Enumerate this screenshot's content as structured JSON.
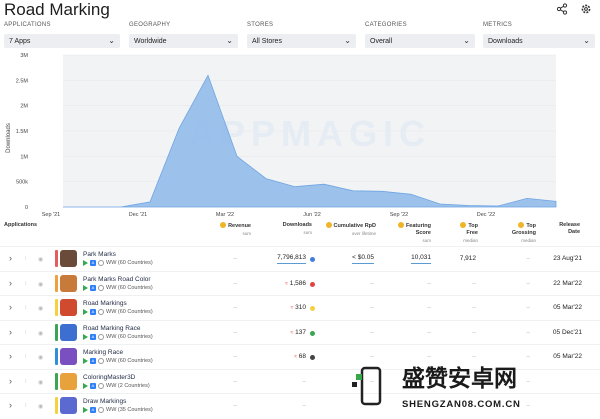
{
  "page": {
    "title": "Road Marking"
  },
  "filters": [
    {
      "label": "APPLICATIONS",
      "value": "7 Apps"
    },
    {
      "label": "GEOGRAPHY",
      "value": "Worldwide"
    },
    {
      "label": "STORES",
      "value": "All Stores"
    },
    {
      "label": "CATEGORIES",
      "value": "Overall"
    },
    {
      "label": "METRICS",
      "value": "Downloads"
    }
  ],
  "chart_data": {
    "type": "area",
    "ylabel": "Downloads",
    "watermark": "APPMAGIC",
    "y_ticks": [
      "0",
      "500k",
      "1M",
      "1.5M",
      "2M",
      "2.5M",
      "3M"
    ],
    "ylim": [
      0,
      3000000
    ],
    "x_ticks": [
      "Sep '21",
      "Dec '21",
      "Mar '22",
      "Jun '22",
      "Sep '22",
      "Dec '22"
    ],
    "x": [
      "Sep '21",
      "Oct '21",
      "Nov '21",
      "Dec '21",
      "Jan '22",
      "Feb '22",
      "Mar '22",
      "Apr '22",
      "May '22",
      "Jun '22",
      "Jul '22",
      "Aug '22",
      "Sep '22",
      "Oct '22",
      "Nov '22",
      "Dec '22",
      "Jan '23",
      "Feb '23"
    ],
    "series": [
      {
        "values": [
          0,
          0,
          0,
          100000,
          1550000,
          2600000,
          1000000,
          560000,
          400000,
          450000,
          320000,
          310000,
          250000,
          60000,
          30000,
          20000,
          170000,
          110000
        ]
      }
    ],
    "grid": true,
    "legend": "none"
  },
  "table": {
    "headers": {
      "applications": "Applications",
      "revenue": "Revenue",
      "revenue_sub": "sum",
      "downloads": "Downloads",
      "downloads_sub": "sum",
      "rpd": "Cumulative RpD",
      "rpd_sub": "over lifetime",
      "featuring": "Featuring Score",
      "featuring_sub": "sum",
      "topfree": "Top Free",
      "topfree_sub": "median",
      "topgrossing": "Top Grossing",
      "topgrossing_sub": "median",
      "release": "Release Date"
    },
    "rows": [
      {
        "name": "Park Marks",
        "meta": "WW (60 Countries)",
        "revenue": "–",
        "downloads": "7,796,813",
        "rpd": "< $0.05",
        "featuring": "10,031",
        "topfree": "7,912",
        "topgrossing": "–",
        "release": "23 Aug'21",
        "bar": "#e45c5c",
        "dot": "#3f7fdc",
        "icon": "#6a4b3a"
      },
      {
        "name": "Park Marks Road Color",
        "meta": "WW (60 Countries)",
        "revenue": "–",
        "downloads": "1,586",
        "rpd": "–",
        "featuring": "–",
        "topfree": "–",
        "topgrossing": "–",
        "release": "22 Mar'22",
        "bar": "#f0a03c",
        "dot": "#e14343",
        "icon": "#c77a3a"
      },
      {
        "name": "Road Markings",
        "meta": "WW (60 Countries)",
        "revenue": "–",
        "downloads": "310",
        "rpd": "–",
        "featuring": "–",
        "topfree": "–",
        "topgrossing": "–",
        "release": "05 Mar'22",
        "bar": "#f5d040",
        "dot": "#f5d040",
        "icon": "#d04a2f"
      },
      {
        "name": "Road Marking Race",
        "meta": "WW (60 Countries)",
        "revenue": "–",
        "downloads": "137",
        "rpd": "–",
        "featuring": "–",
        "topfree": "–",
        "topgrossing": "–",
        "release": "05 Dec'21",
        "bar": "#3aa655",
        "dot": "#3aa655",
        "icon": "#3d6fd0"
      },
      {
        "name": "Marking Race",
        "meta": "WW (60 Countries)",
        "revenue": "–",
        "downloads": "68",
        "rpd": "–",
        "featuring": "–",
        "topfree": "–",
        "topgrossing": "–",
        "release": "05 Mar'22",
        "bar": "#2f8fd8",
        "dot": "#444444",
        "icon": "#7a4fc0"
      },
      {
        "name": "ColoringMaster3D",
        "meta": "WW (2 Countries)",
        "revenue": "–",
        "downloads": "–",
        "rpd": "–",
        "featuring": "–",
        "topfree": "–",
        "topgrossing": "–",
        "release": "",
        "bar": "#3aa655",
        "dot": "",
        "icon": "#e8a23c"
      },
      {
        "name": "Draw Markings",
        "meta": "WW (35 Countries)",
        "revenue": "–",
        "downloads": "–",
        "rpd": "–",
        "featuring": "–",
        "topfree": "–",
        "topgrossing": "–",
        "release": "",
        "bar": "#f5d040",
        "dot": "",
        "icon": "#5a6ad0"
      }
    ]
  },
  "watermark": {
    "cn": "盛赞安卓网",
    "en": "SHENGZAN08.COM.CN"
  }
}
